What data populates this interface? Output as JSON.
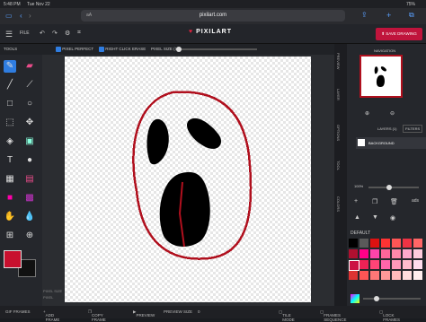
{
  "status": {
    "time": "5:48 PM",
    "date": "Tue Nov 22",
    "battery": "75%"
  },
  "browser": {
    "url": "pixilart.com",
    "aa": "aA"
  },
  "app": {
    "logo": "PIXILART",
    "save_label": "SAVE DRAWING",
    "file_label": "FILE"
  },
  "options": {
    "pixel_perfect": "PIXEL PERFECT",
    "right_click_erase": "RIGHT CLICK ERASE",
    "pixel_size": "PIXEL SIZE (1)"
  },
  "tools_label": "TOOLS",
  "canvas_status": {
    "pixel_size_text": "PIXEL SIZE",
    "coords": "PIXEL"
  },
  "side_tabs": [
    "PREVIEW",
    "LAYER",
    "OPTIONS",
    "TOOL",
    "COLORS"
  ],
  "navigation": {
    "title": "NAVIGATION"
  },
  "layers": {
    "title": "LAYERS (1)",
    "filters_label": "FILTERS",
    "layer_name": "BACKGROUND"
  },
  "zoom": {
    "percent": "100%"
  },
  "palette": {
    "name": "DEFAULT",
    "ads_label": "ads"
  },
  "bottom": {
    "frames": "GIF FRAMES",
    "add_frame": "ADD FRAME",
    "copy_frame": "COPY FRAME",
    "preview": "PREVIEW",
    "preview_size": "PREVIEW SIZE",
    "preview_size_val": "0",
    "tile_mode": "TILE MODE",
    "frames_sequence": "FRAMES SEQUENCE",
    "lock_frames": "LOCK FRAMES"
  },
  "colors": {
    "primary": "#c8102e",
    "secondary": "#111111",
    "accent": "#c0143c"
  }
}
